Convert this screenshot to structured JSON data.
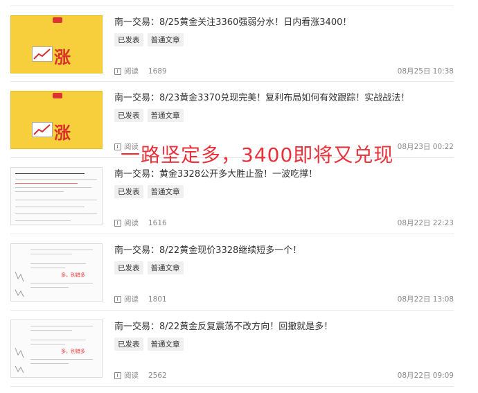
{
  "articles": [
    {
      "title": "南一交易：8/25黄金关注3360强弱分水！日内看涨3400！",
      "tags": [
        "已发表",
        "普通文章"
      ],
      "read_label": "阅读",
      "read_count": "1689",
      "date": "08月25日 10:38",
      "thumb_type": "rise",
      "thumb_char": "涨"
    },
    {
      "title": "南一交易：8/23黄金3370兑现完美！复利布局如何有效跟踪！实战战法！",
      "tags": [
        "已发表",
        "普通文章"
      ],
      "read_label": "阅读",
      "read_count": "",
      "date": "08月23日 00:22",
      "thumb_type": "rise",
      "thumb_char": "涨"
    },
    {
      "title": "南一交易：黄金3328公开多大胜止盈！一波吃撑！",
      "tags": [
        "已发表",
        "普通文章"
      ],
      "read_label": "阅读",
      "read_count": "1616",
      "date": "08月22日 22:23",
      "thumb_type": "doc",
      "thumb_char": ""
    },
    {
      "title": "南一交易：8/22黄金现价3328继续短多一个！",
      "tags": [
        "已发表",
        "普通文章"
      ],
      "read_label": "阅读",
      "read_count": "1801",
      "date": "08月22日 13:08",
      "thumb_type": "doc",
      "thumb_char": "多，别错多"
    },
    {
      "title": "南一交易：8/22黄金反复震荡不改方向！回撤就是多！",
      "tags": [
        "已发表",
        "普通文章"
      ],
      "read_label": "阅读",
      "read_count": "2562",
      "date": "08月22日 09:09",
      "thumb_type": "doc",
      "thumb_char": "多，别错多"
    }
  ],
  "overlay_text": "一路坚定多，3400即将又兑现",
  "colors": {
    "accent": "#e8313a",
    "thumb_yellow": "#f7cf3c"
  }
}
